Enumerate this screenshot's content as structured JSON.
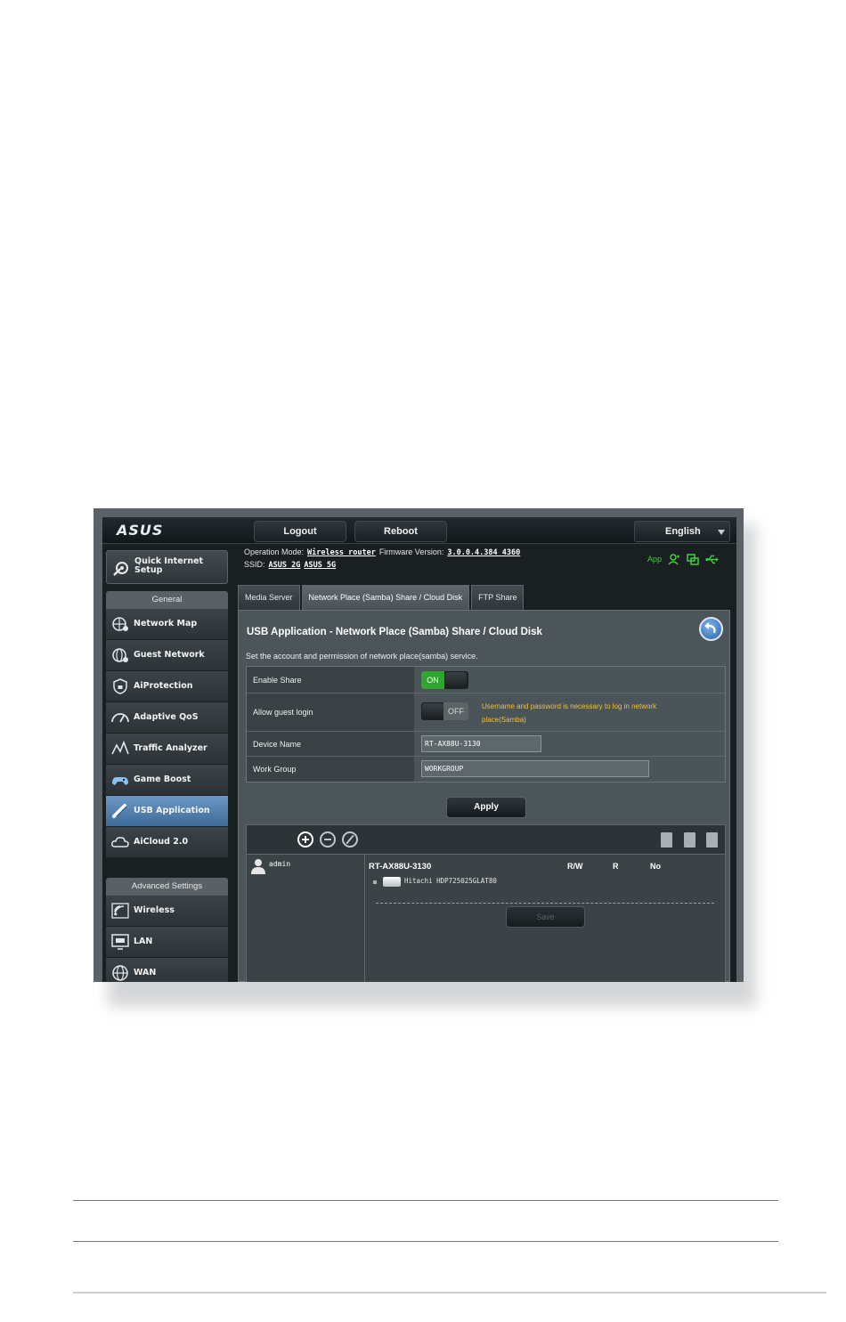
{
  "app": {
    "logo": "ASUS"
  },
  "topbar": {
    "logout_label": "Logout",
    "reboot_label": "Reboot",
    "language": "English"
  },
  "info": {
    "operation_mode_label": "Operation Mode:",
    "operation_mode_value": "Wireless router",
    "firmware_label": "Firmware Version:",
    "firmware_value": "3.0.0.4.384_4360",
    "ssid_label": "SSID:",
    "ssid_2g": "ASUS_2G",
    "ssid_5g": "ASUS_5G",
    "app_label": "App"
  },
  "sidebar": {
    "quick_setup_line1": "Quick Internet",
    "quick_setup_line2": "Setup",
    "general_header": "General",
    "general_items": [
      {
        "label": "Network Map",
        "icon": "network-map-icon"
      },
      {
        "label": "Guest Network",
        "icon": "guest-network-icon"
      },
      {
        "label": "AiProtection",
        "icon": "aiprotection-icon"
      },
      {
        "label": "Adaptive QoS",
        "icon": "adaptive-qos-icon"
      },
      {
        "label": "Traffic Analyzer",
        "icon": "traffic-analyzer-icon"
      },
      {
        "label": "Game Boost",
        "icon": "game-boost-icon"
      },
      {
        "label": "USB Application",
        "icon": "usb-application-icon"
      },
      {
        "label": "AiCloud 2.0",
        "icon": "aicloud-icon"
      }
    ],
    "advanced_header": "Advanced Settings",
    "advanced_items": [
      {
        "label": "Wireless",
        "icon": "wireless-icon"
      },
      {
        "label": "LAN",
        "icon": "lan-icon"
      },
      {
        "label": "WAN",
        "icon": "wan-icon"
      }
    ]
  },
  "tabs": [
    "Media Server",
    "Network Place (Samba) Share / Cloud Disk",
    "FTP Share"
  ],
  "content": {
    "title": "USB Application - Network Place (Samba) Share / Cloud Disk",
    "subtitle": "Set the account and permission of network place(samba) service.",
    "fields": {
      "enable_share_label": "Enable Share",
      "enable_share_state": "ON",
      "guest_login_label": "Allow guest login",
      "guest_login_state": "OFF",
      "guest_login_warning": "Username and password is necessary to log in network place(Samba)",
      "device_name_label": "Device Name",
      "device_name_value": "RT-AX88U-3130",
      "work_group_label": "Work Group",
      "work_group_value": "WORKGROUP"
    },
    "apply_label": "Apply",
    "accounts": {
      "user": "admin",
      "device": "RT-AX88U-3130",
      "perm_headers": [
        "R/W",
        "R",
        "No"
      ],
      "disk": "Hitachi HDP725025GLAT80",
      "save_label": "Save"
    }
  },
  "colors": {
    "accent_on": "#2fa52f",
    "warning": "#f2c230",
    "active_menu": "#5585b5"
  }
}
